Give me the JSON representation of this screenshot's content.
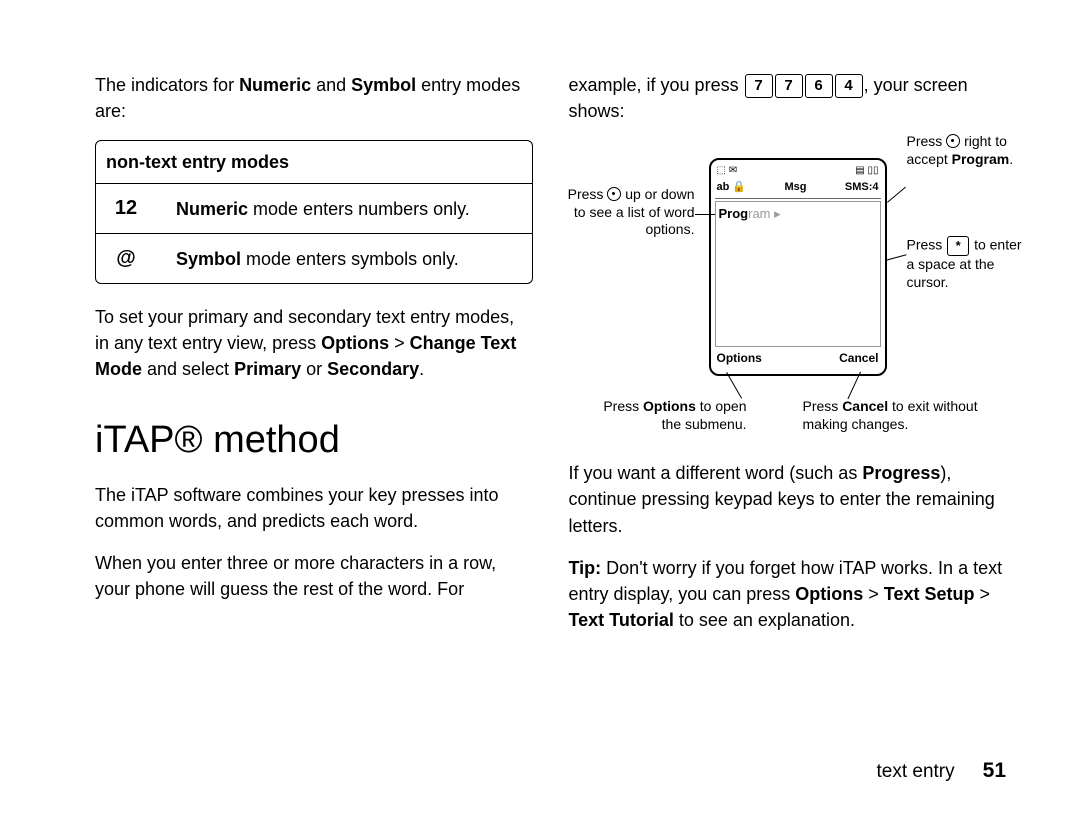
{
  "left": {
    "intro": "The indicators for ",
    "intro_b1": "Numeric",
    "intro_mid": " and ",
    "intro_b2": "Symbol",
    "intro_end": " entry modes are:",
    "table": {
      "header": "non-text entry modes",
      "rows": [
        {
          "icon": "12",
          "bold": "Numeric",
          "rest": " mode enters numbers only."
        },
        {
          "icon": "@",
          "bold": "Symbol",
          "rest": " mode enters symbols only."
        }
      ]
    },
    "p2_a": "To set your primary and secondary text entry modes, in any text entry view, press ",
    "p2_b1": "Options",
    "p2_gt1": " > ",
    "p2_b2": "Change Text Mode",
    "p2_mid": " and select ",
    "p2_b3": "Primary",
    "p2_or": " or ",
    "p2_b4": "Secondary",
    "p2_end": ".",
    "h1": "iTAP® method",
    "p3": "The iTAP software combines your key presses into common words, and predicts each word.",
    "p4": "When you enter three or more characters in a row, your phone will guess the rest of the word. For"
  },
  "right": {
    "p1_a": "example, if you press ",
    "keys": [
      "7",
      "7",
      "6",
      "4"
    ],
    "p1_b": ", your screen shows:",
    "phone": {
      "status_left": "⬚ ✉",
      "status_right": "▤ ▯▯",
      "row2_left": "ab 🔒",
      "row2_center": "Msg",
      "row2_right": "SMS:4",
      "word_bold": "Prog",
      "word_gray": "ram ▸",
      "soft_left": "Options",
      "soft_right": "Cancel"
    },
    "annot": {
      "left": "Press ⊙ up or down to see a list of word options.",
      "tr1_a": "Press ⊙ right to accept ",
      "tr1_b": "Program",
      "tr1_c": ".",
      "r2_a": "Press ",
      "r2_key": "*",
      "r2_b": " to enter a space at the cursor.",
      "bl_a": "Press ",
      "bl_b": "Options",
      "bl_c": " to open the submenu.",
      "br_a": "Press ",
      "br_b": "Cancel",
      "br_c": " to exit without making changes."
    },
    "p2_a": "If you want a different word (such as ",
    "p2_b": "Progress",
    "p2_c": "), continue pressing keypad keys to enter the remaining letters.",
    "p3_a": "Tip:",
    "p3_b": " Don't worry if you forget how iTAP works. In a text entry display, you can press ",
    "p3_c": "Options",
    "p3_gt1": " > ",
    "p3_d": "Text Setup",
    "p3_gt2": " > ",
    "p3_e": "Text Tutorial",
    "p3_f": " to see an explanation."
  },
  "footer": {
    "section": "text entry",
    "page": "51"
  }
}
